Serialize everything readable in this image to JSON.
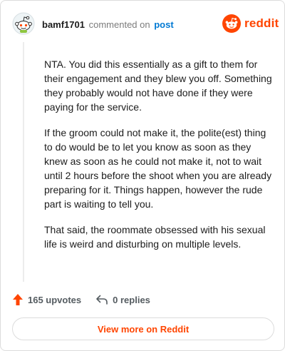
{
  "header": {
    "username": "bamf1701",
    "commented_text": "commented on",
    "post_link": "post",
    "brand": "reddit"
  },
  "comment": {
    "paragraphs": [
      "NTA. You did this essentially as a gift to them for their engagement and they blew you off. Something they probably would not have done if they were paying for the service.",
      "If the groom could not make it, the polite(est) thing to do would be to let you know as soon as they knew as soon as he could not make it, not to wait until 2 hours before the shoot when you are already preparing for it. Things happen, however the rude part is waiting to tell you.",
      "That said, the roommate obsessed with his sexual life is weird and disturbing on multiple levels."
    ]
  },
  "actions": {
    "upvotes": "165 upvotes",
    "replies": "0 replies"
  },
  "footer": {
    "view_more": "View more on Reddit"
  },
  "colors": {
    "brand": "#ff4500",
    "link": "#0079d3",
    "text": "#1c1c1c",
    "muted": "#7c7c7c"
  },
  "icons": {
    "avatar": "snoo-avatar-icon",
    "logo": "reddit-logo-icon",
    "upvote": "upvote-arrow-icon",
    "reply": "reply-arrow-icon"
  }
}
